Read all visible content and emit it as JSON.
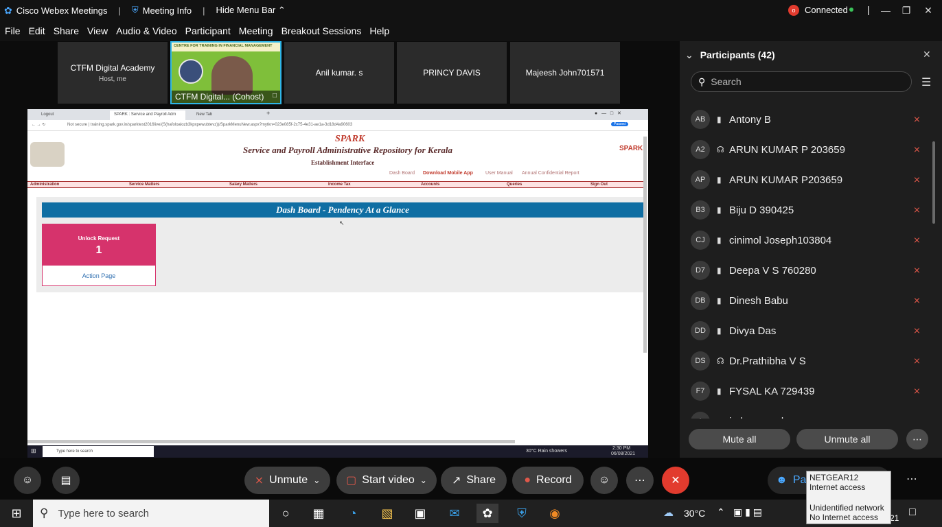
{
  "titlebar": {
    "app": "Cisco Webex Meetings",
    "meeting_info": "Meeting Info",
    "hide_menu": "Hide Menu Bar",
    "status": "Connected"
  },
  "menubar": [
    "File",
    "Edit",
    "Share",
    "View",
    "Audio & Video",
    "Participant",
    "Meeting",
    "Breakout Sessions",
    "Help"
  ],
  "tiles": [
    {
      "name": "CTFM Digital Academy",
      "sub": "Host, me"
    },
    {
      "name": "CTFM Digital...  (Cohost)",
      "banner": "CENTRE FOR TRAINING IN FINANCIAL MANAGEMENT"
    },
    {
      "name": "Anil kumar. s"
    },
    {
      "name": "PRINCY DAVIS"
    },
    {
      "name": "Majeesh John701571"
    }
  ],
  "shared": {
    "tabs": [
      "Logout",
      "SPARK : Service and Payroll Adm",
      "New Tab"
    ],
    "address": "Not secure  |  training.spark.gov.in/sparktest2016live/(S(hafoloalozb3kpxpewubtevz))/SparkMenuNew.aspx?mytkn=023e085f-2c75-4e31-ae1a-3d18d4a90603",
    "paused": "Paused",
    "logo": "SPARK",
    "title": "Service and Payroll Administrative Repository for Kerala",
    "subtitle": "Establishment Interface",
    "nav": [
      "Dash Board",
      "Download Mobile App",
      "User Manual",
      "Annual Confidential Report"
    ],
    "menu": [
      "Administration",
      "Service Matters",
      "Salary Matters",
      "Income Tax",
      "Accounts",
      "Queries",
      "Sign Out"
    ],
    "dash_header": "Dash Board - Pendency At a Glance",
    "card_label": "Unlock Request",
    "card_count": "1",
    "action": "Action Page",
    "taskbar_search": "Type here to search",
    "weather": "30°C  Rain showers",
    "time": "2:30 PM",
    "date": "06/08/2021"
  },
  "participants": {
    "header": "Participants (42)",
    "search_placeholder": "Search",
    "list": [
      {
        "initials": "AB",
        "name": "Antony B",
        "device": "phone"
      },
      {
        "initials": "A2",
        "name": "ARUN KUMAR P 203659",
        "device": "headset"
      },
      {
        "initials": "AP",
        "name": "ARUN KUMAR P203659",
        "device": "phone"
      },
      {
        "initials": "B3",
        "name": "Biju D 390425",
        "device": "phone"
      },
      {
        "initials": "CJ",
        "name": "cinimol Joseph103804",
        "device": "phone"
      },
      {
        "initials": "D7",
        "name": "Deepa V S 760280",
        "device": "phone"
      },
      {
        "initials": "DB",
        "name": "Dinesh Babu",
        "device": "phone"
      },
      {
        "initials": "DD",
        "name": "Divya Das",
        "device": "phone"
      },
      {
        "initials": "DS",
        "name": "Dr.Prathibha V S",
        "device": "headset"
      },
      {
        "initials": "F7",
        "name": "FYSAL KA 729439",
        "device": "phone"
      },
      {
        "initials": "I",
        "name": "indraprasad",
        "device": "phone"
      }
    ],
    "mute_all": "Mute all",
    "unmute_all": "Unmute all"
  },
  "controls": {
    "unmute": "Unmute",
    "start_video": "Start video",
    "share": "Share",
    "record": "Record",
    "participants_partial": "Par",
    "participants_partial_end": "t"
  },
  "taskbar": {
    "search_placeholder": "Type here to search",
    "temp": "30°C",
    "clock_partial": "21"
  },
  "net_popup": {
    "ssid": "NETGEAR12",
    "ssid_status": "Internet access",
    "network": "Unidentified network",
    "network_status": "No Internet access"
  }
}
